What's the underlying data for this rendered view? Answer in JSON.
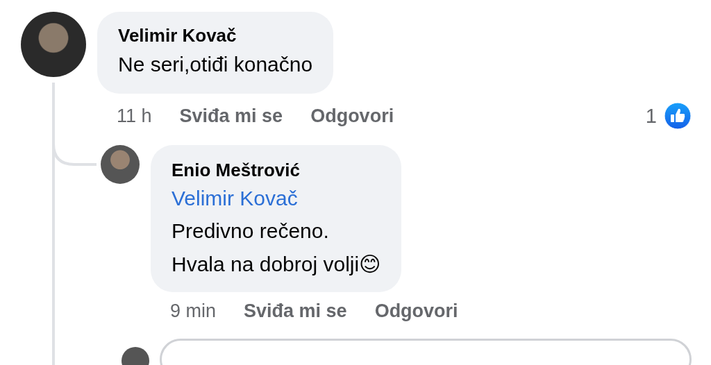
{
  "comments": [
    {
      "author": "Velimir Kovač",
      "lines": [
        "Ne seri,otiđi konačno"
      ],
      "time": "11 h",
      "like_action": "Sviđa mi se",
      "reply_action": "Odgovori",
      "reaction_count": "1",
      "replies": [
        {
          "author": "Enio Meštrović",
          "mention": "Velimir Kovač",
          "lines": [
            "Predivno rečeno.",
            "Hvala na dobroj volji😊"
          ],
          "time": "9 min",
          "like_action": "Sviđa mi se",
          "reply_action": "Odgovori"
        }
      ]
    }
  ]
}
